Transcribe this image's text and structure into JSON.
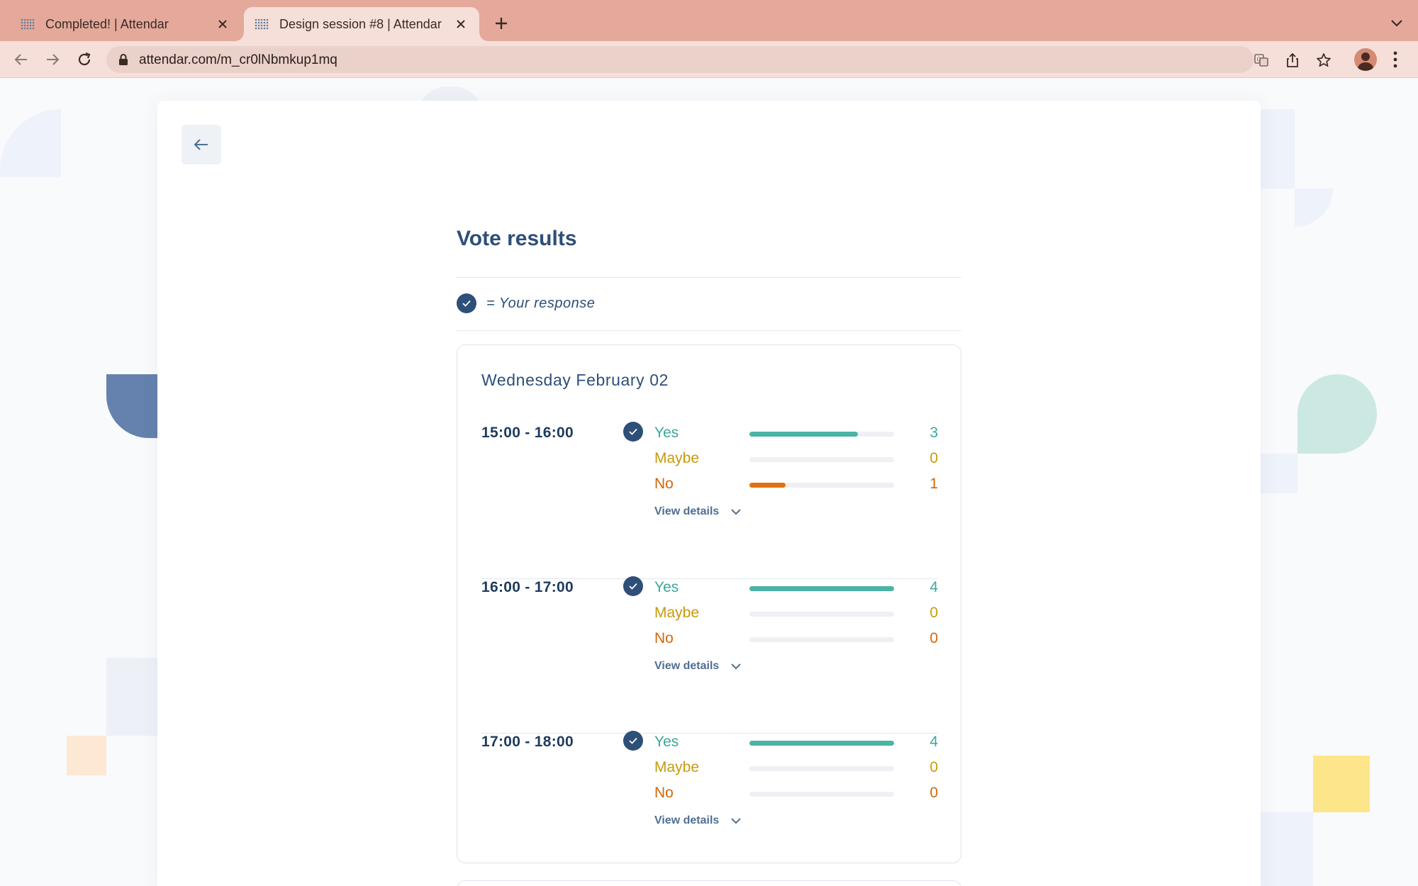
{
  "browser": {
    "tabs": [
      {
        "title": "Completed! | Attendar",
        "active": false
      },
      {
        "title": "Design session #8 | Attendar",
        "active": true
      }
    ],
    "url": "attendar.com/m_cr0lNbmkup1mq"
  },
  "page": {
    "title": "Vote results",
    "legend": "= Your response",
    "day": {
      "label": "Wednesday February 02",
      "slots": [
        {
          "time": "15:00 - 16:00",
          "responded": true,
          "rows": [
            {
              "label": "Yes",
              "count": "3",
              "fraction": 0.75
            },
            {
              "label": "Maybe",
              "count": "0",
              "fraction": 0
            },
            {
              "label": "No",
              "count": "1",
              "fraction": 0.25
            }
          ],
          "details_label": "View details"
        },
        {
          "time": "16:00 - 17:00",
          "responded": true,
          "rows": [
            {
              "label": "Yes",
              "count": "4",
              "fraction": 1.0
            },
            {
              "label": "Maybe",
              "count": "0",
              "fraction": 0
            },
            {
              "label": "No",
              "count": "0",
              "fraction": 0
            }
          ],
          "details_label": "View details"
        },
        {
          "time": "17:00 - 18:00",
          "responded": true,
          "rows": [
            {
              "label": "Yes",
              "count": "4",
              "fraction": 1.0
            },
            {
              "label": "Maybe",
              "count": "0",
              "fraction": 0
            },
            {
              "label": "No",
              "count": "0",
              "fraction": 0
            }
          ],
          "details_label": "View details"
        }
      ]
    }
  },
  "colors": {
    "brand": "#2d4f78",
    "yes": "#3ca89c",
    "maybe": "#c89a0a",
    "no": "#d4660c",
    "tabstrip": "#e4a99a"
  }
}
